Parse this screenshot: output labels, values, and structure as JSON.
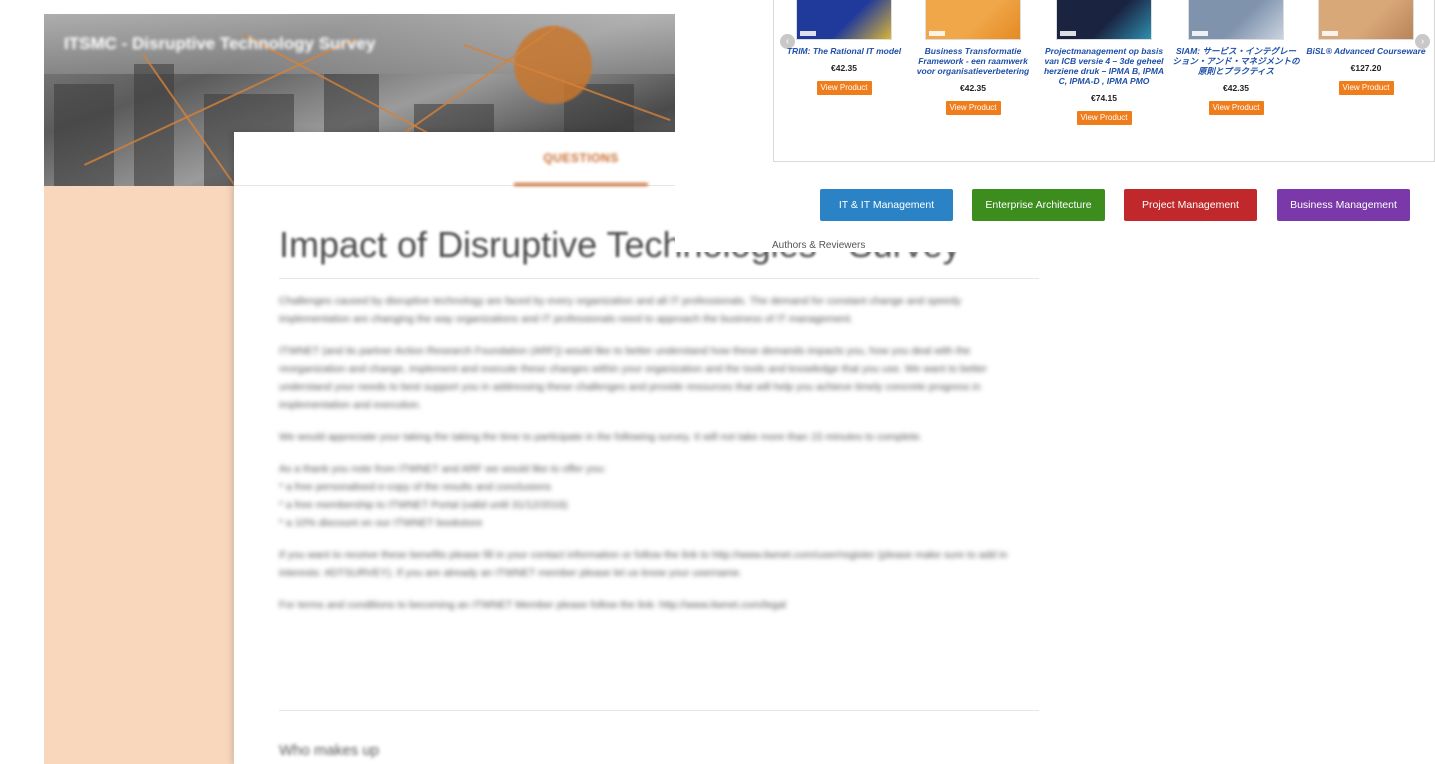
{
  "survey": {
    "brand": "ITSMC - Disruptive Technology Survey",
    "tab_questions": "QUESTIONS",
    "title": "Impact of Disruptive Technologies - Survey",
    "paragraphs": [
      "Challenges caused by disruptive technology are faced by every organization and all IT professionals. The demand for constant change and speedy implementation are changing the way organizations and IT professionals need to approach the business of IT management.",
      "ITWNET (and its partner Action Research Foundation (ARF)) would like to better understand how these demands impacts you, how you deal with the reorganization and change, implement and execute these changes within your organization and the tools and knowledge that you use. We want to better understand your needs to best support you in addressing these challenges and provide resources that will help you achieve timely concrete progress in implementation and execution.",
      "We would appreciate your taking the taking the time to participate in the following survey. It will not take more than 15 minutes to complete.",
      "As a thank you note from ITWNET and ARF we would like to offer you:"
    ],
    "bullets": [
      "* a free personalised e-copy of the results and conclusions",
      "* a free membership to ITWNET Portal (valid until 31/12/2016)",
      "* a 10% discount on our ITWNET bookstore"
    ],
    "paragraph_after": "If you want to receive these benefits please fill in your contact information or follow the link to http://www.itwnet.com/user/register (please make sure to add in interests: #DTSURVEY). If you are already an ITWNET member please let us know your username.",
    "terms": "For terms and conditions to becoming an ITWNET Member please follow the link: http://www.itwnet.com/legal",
    "next_section": "Who makes up"
  },
  "shop": {
    "products": [
      {
        "title": "TRIM: The Rational IT model",
        "price": "€42.35",
        "button": "View Product",
        "thumb_color": "#1f3a9a",
        "thumb_accent": "#d9b43a"
      },
      {
        "title": "Business Transformatie Framework - een raamwerk voor organisatieverbetering",
        "price": "€42.35",
        "button": "View Product",
        "thumb_color": "#f0a74a",
        "thumb_accent": "#e58a22"
      },
      {
        "title": "Projectmanagement op basis van ICB versie 4 – 3de geheel herziene druk – IPMA B, IPMA C, IPMA-D , IPMA PMO",
        "price": "€74.15",
        "button": "View Product",
        "thumb_color": "#1a2340",
        "thumb_accent": "#2f8fb0"
      },
      {
        "title": "SIAM: サービス・インテグレーション・アンド・マネジメントの原則とプラクティス",
        "price": "€42.35",
        "button": "View Product",
        "thumb_color": "#7f93ad",
        "thumb_accent": "#c9d3e0"
      },
      {
        "title": "BiSL® Advanced Courseware",
        "price": "€127.20",
        "button": "View Product",
        "thumb_color": "#d9a878",
        "thumb_accent": "#b8845a"
      }
    ],
    "categories": [
      {
        "label": "IT & IT Management",
        "color": "#2b83c6"
      },
      {
        "label": "Enterprise Architecture",
        "color": "#3d8c1e"
      },
      {
        "label": "Project Management",
        "color": "#c0282b"
      },
      {
        "label": "Business Management",
        "color": "#7a38a8"
      }
    ],
    "authors_label": "Authors & Reviewers"
  }
}
